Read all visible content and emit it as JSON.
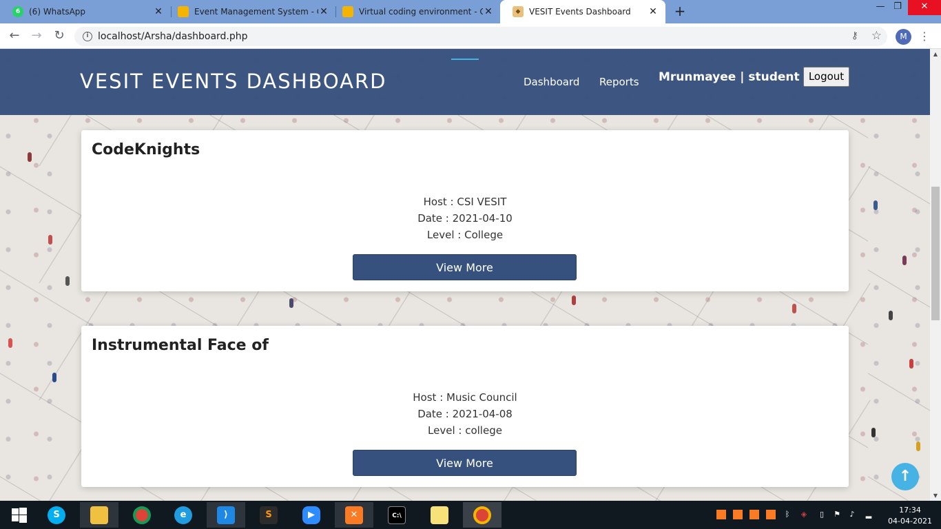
{
  "browser": {
    "tabs": [
      {
        "title": "(6) WhatsApp",
        "favicon": "whatsapp-icon",
        "badge": "6",
        "active": false
      },
      {
        "title": "Event Management System - Goo",
        "favicon": "slides-icon",
        "active": false
      },
      {
        "title": "Virtual coding environment - Goo",
        "favicon": "slides-icon",
        "active": false
      },
      {
        "title": "VESIT Events Dashboard",
        "favicon": "site-icon",
        "active": true
      }
    ],
    "url": "localhost/Arsha/dashboard.php",
    "profile_initial": "M"
  },
  "site": {
    "brand": "VESIT EVENTS DASHBOARD",
    "nav": [
      "Dashboard",
      "Reports"
    ],
    "user_label": "Mrunmayee | student",
    "logout_label": "Logout"
  },
  "events": [
    {
      "title": "CodeKnights",
      "host": "Host : CSI VESIT",
      "date": "Date : 2021-04-10",
      "level": "Level : College",
      "button": "View More"
    },
    {
      "title": "Instrumental Face of",
      "host": "Host : Music Council",
      "date": "Date : 2021-04-08",
      "level": "Level : college",
      "button": "View More"
    }
  ],
  "taskbar": {
    "time": "17:34",
    "date": "04-04-2021"
  },
  "colors": {
    "header_bg": "#37517e",
    "accent": "#47b2e4",
    "tabstrip": "#7a9fd6"
  }
}
